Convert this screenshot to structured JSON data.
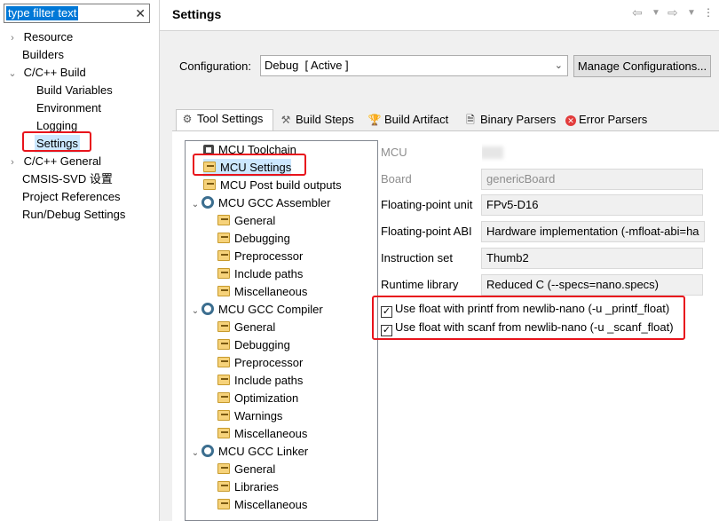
{
  "filter": {
    "text": "type filter text",
    "clear_glyph": "✕"
  },
  "nav": {
    "items": [
      {
        "label": "Resource",
        "expandable": true,
        "indent": 0
      },
      {
        "label": "Builders",
        "expandable": false,
        "indent": 0
      },
      {
        "label": "C/C++ Build",
        "expandable": true,
        "expanded": true,
        "indent": 0
      },
      {
        "label": "Build Variables",
        "indent": 1
      },
      {
        "label": "Environment",
        "indent": 1
      },
      {
        "label": "Logging",
        "indent": 1
      },
      {
        "label": "Settings",
        "indent": 1,
        "selected": true
      },
      {
        "label": "C/C++ General",
        "expandable": true,
        "indent": 0
      },
      {
        "label": "CMSIS-SVD 设置",
        "indent": 0
      },
      {
        "label": "Project References",
        "indent": 0
      },
      {
        "label": "Run/Debug Settings",
        "indent": 0
      }
    ]
  },
  "header": {
    "title": "Settings"
  },
  "config": {
    "label": "Configuration:",
    "value": "Debug  [ Active ]",
    "manage_label": "Manage Configurations..."
  },
  "tabs": [
    {
      "label": "Tool Settings",
      "icon": "tool-settings-icon",
      "active": true
    },
    {
      "label": "Build Steps",
      "icon": "build-steps-icon"
    },
    {
      "label": "Build Artifact",
      "icon": "build-artifact-icon"
    },
    {
      "label": "Binary Parsers",
      "icon": "binary-parsers-icon"
    },
    {
      "label": "Error Parsers",
      "icon": "error-parsers-icon"
    }
  ],
  "tree": {
    "toolchain": "MCU Toolchain",
    "mcu_settings": "MCU Settings",
    "post_build": "MCU Post build outputs",
    "assembler": {
      "label": "MCU GCC Assembler",
      "children": [
        "General",
        "Debugging",
        "Preprocessor",
        "Include paths",
        "Miscellaneous"
      ]
    },
    "compiler": {
      "label": "MCU GCC Compiler",
      "children": [
        "General",
        "Debugging",
        "Preprocessor",
        "Include paths",
        "Optimization",
        "Warnings",
        "Miscellaneous"
      ]
    },
    "linker": {
      "label": "MCU GCC Linker",
      "children": [
        "General",
        "Libraries",
        "Miscellaneous"
      ]
    }
  },
  "fields": {
    "mcu": {
      "label": "MCU",
      "value": ""
    },
    "board": {
      "label": "Board",
      "value": "genericBoard"
    },
    "fpu": {
      "label": "Floating-point unit",
      "value": "FPv5-D16"
    },
    "fabi": {
      "label": "Floating-point ABI",
      "value": "Hardware implementation (-mfloat-abi=ha"
    },
    "iset": {
      "label": "Instruction set",
      "value": "Thumb2"
    },
    "rtlib": {
      "label": "Runtime library",
      "value": "Reduced C (--specs=nano.specs)"
    }
  },
  "checks": {
    "printf": {
      "label": "Use float with printf from newlib-nano (-u _printf_float)",
      "checked": true
    },
    "scanf": {
      "label": "Use float with scanf from newlib-nano (-u _scanf_float)",
      "checked": true
    }
  },
  "colors": {
    "highlight": "#e8141c",
    "selection": "#0078d7"
  }
}
